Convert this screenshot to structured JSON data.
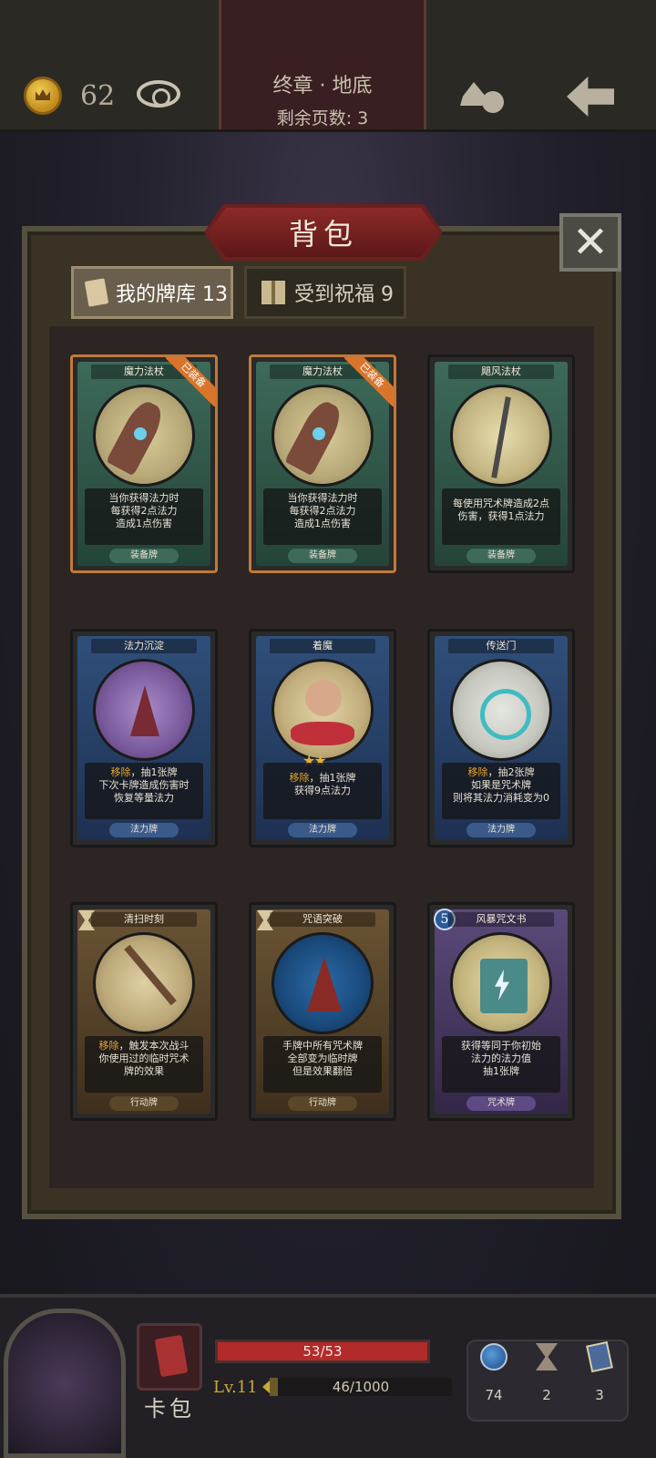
{
  "topbar": {
    "gold": "62",
    "chapter": "终章 · 地底",
    "pages_left": "剩余页数: 3"
  },
  "panel": {
    "title": "背包",
    "close": "✕",
    "tabs": [
      {
        "label": "我的牌库 13",
        "active": true
      },
      {
        "label": "受到祝福 9",
        "active": false
      }
    ]
  },
  "cards": [
    {
      "name": "魔力法杖",
      "desc_lines": [
        "当你获得法力时",
        "每获得2点法力",
        "造成1点伤害"
      ],
      "type": "装备牌",
      "badge": "已装备",
      "color": "green"
    },
    {
      "name": "魔力法杖",
      "desc_lines": [
        "当你获得法力时",
        "每获得2点法力",
        "造成1点伤害"
      ],
      "type": "装备牌",
      "badge": "已装备",
      "color": "green"
    },
    {
      "name": "飓风法杖",
      "desc_lines": [
        "每使用咒术牌造成2点",
        "伤害，获得1点法力"
      ],
      "type": "装备牌",
      "color": "green"
    },
    {
      "name": "法力沉淀",
      "desc_keyword": "移除",
      "desc_rest": "，抽1张牌",
      "desc_lines": [
        "下次卡牌造成伤害时",
        "恢复等量法力"
      ],
      "type": "法力牌",
      "color": "blue"
    },
    {
      "name": "着魔",
      "desc_keyword": "移除",
      "desc_rest": "，抽1张牌",
      "desc_lines": [
        "获得9点法力"
      ],
      "type": "法力牌",
      "color": "blue",
      "stars": "★★"
    },
    {
      "name": "传送门",
      "desc_keyword": "移除",
      "desc_rest": "，抽2张牌",
      "desc_lines": [
        "如果是咒术牌",
        "则将其法力消耗变为0"
      ],
      "type": "法力牌",
      "color": "blue"
    },
    {
      "name": "清扫时刻",
      "desc_keyword": "移除",
      "desc_rest": "，触发本次战斗",
      "desc_lines": [
        "你使用过的临时咒术",
        "牌的效果"
      ],
      "type": "行动牌",
      "color": "brown"
    },
    {
      "name": "咒语突破",
      "desc_lines": [
        "手牌中所有咒术牌",
        "全部变为临时牌",
        "但是效果翻倍"
      ],
      "type": "行动牌",
      "color": "brown"
    },
    {
      "name": "风暴咒文书",
      "cost": "5",
      "desc_lines": [
        "获得等同于你初始",
        "法力的法力值",
        "抽1张牌"
      ],
      "type": "咒术牌",
      "color": "purple"
    }
  ],
  "bottom": {
    "card_bag_label": "卡包",
    "hp": "53/53",
    "hp_fraction": 1.0,
    "level": "Lv.11",
    "xp": "46/1000",
    "xp_fraction": 0.046,
    "stats": [
      {
        "icon": "potion-icon",
        "value": "74"
      },
      {
        "icon": "hourglass-icon",
        "value": "2"
      },
      {
        "icon": "deck-icon",
        "value": "3"
      }
    ]
  }
}
